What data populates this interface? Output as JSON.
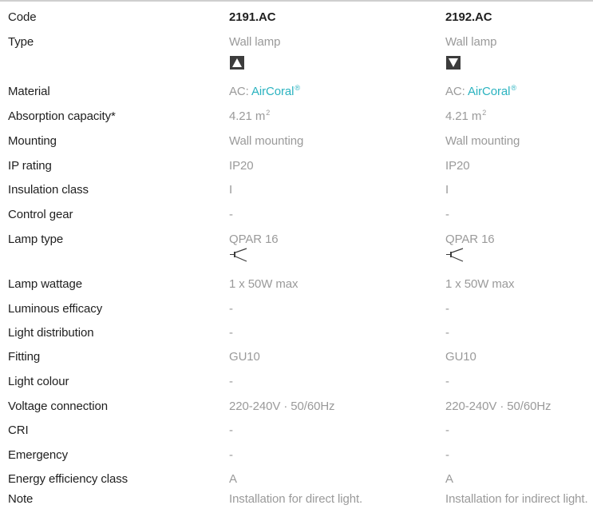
{
  "columns": [
    {
      "code": "2191.AC",
      "type_icon": "triangle-up-icon"
    },
    {
      "code": "2192.AC",
      "type_icon": "triangle-down-icon"
    }
  ],
  "labels": {
    "code": "Code",
    "type": "Type",
    "material": "Material",
    "absorption": "Absorption capacity*",
    "mounting": "Mounting",
    "ip": "IP rating",
    "insulation": "Insulation class",
    "gear": "Control gear",
    "lamp_type": "Lamp type",
    "wattage": "Lamp wattage",
    "efficacy": "Luminous efficacy",
    "distribution": "Light distribution",
    "fitting": "Fitting",
    "colour": "Light colour",
    "voltage": "Voltage connection",
    "cri": "CRI",
    "emergency": "Emergency",
    "energy": "Energy efficiency class",
    "note": "Note"
  },
  "values": {
    "type": "Wall lamp",
    "material_prefix": "AC: ",
    "material_link": "AirCoral",
    "material_mark": "®",
    "absorption_value": "4.21 m",
    "absorption_unit_exp": "2",
    "mounting": "Wall mounting",
    "ip": "IP20",
    "insulation": "I",
    "gear": "-",
    "lamp_type": "QPAR 16",
    "lamp_icon": "qpar-lamp-icon",
    "wattage": "1 x 50W max",
    "efficacy": "-",
    "distribution": "-",
    "fitting": "GU10",
    "colour": "-",
    "voltage": "220-240V · 50/60Hz",
    "cri": "-",
    "emergency": "-",
    "energy": "A",
    "note_1": "Installation for direct light.",
    "note_2": "Installation for indirect light."
  },
  "colors": {
    "label": "#1f1f1f",
    "value": "#9a9a9a",
    "link": "#2bb3c0",
    "icon_dark": "#3c3c3c"
  }
}
